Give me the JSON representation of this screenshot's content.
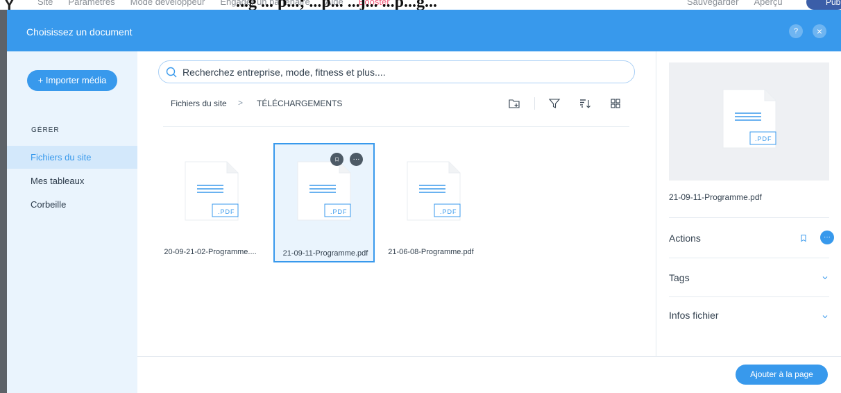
{
  "background_editor": {
    "menu": [
      "Site",
      "Paramètres",
      "Mode développeur",
      "Engager un partenaire",
      "Aide",
      "Booster"
    ],
    "title_partial": "...g ... p...; ...p... ...j... ...p...g...",
    "right_items": [
      "Sauvegarder",
      "Aperçu"
    ],
    "publish_label": "Publi"
  },
  "modal": {
    "title": "Choisissez un document",
    "help_label": "?",
    "close_label": "×"
  },
  "sidebar": {
    "import_label": "+ Importer média",
    "section_title": "GÉRER",
    "items": [
      {
        "label": "Fichiers du site",
        "active": true
      },
      {
        "label": "Mes tableaux",
        "active": false
      },
      {
        "label": "Corbeille",
        "active": false
      }
    ]
  },
  "search": {
    "placeholder": "Recherchez entreprise, mode, fitness et plus...."
  },
  "breadcrumb": {
    "root": "Fichiers du site",
    "separator": ">",
    "current": "TÉLÉCHARGEMENTS"
  },
  "toolbar": {
    "icons": [
      "new-folder-icon",
      "filter-icon",
      "sort-icon",
      "grid-view-icon"
    ]
  },
  "files": [
    {
      "name": "20-09-21-02-Programme....",
      "type_label": ".PDF",
      "selected": false
    },
    {
      "name": "21-09-11-Programme.pdf",
      "type_label": ".PDF",
      "selected": true
    },
    {
      "name": "21-06-08-Programme.pdf",
      "type_label": ".PDF",
      "selected": false
    }
  ],
  "selected_badges": {
    "bookmark": "bookmark-icon",
    "more": "···"
  },
  "right_panel": {
    "preview_type_label": ".PDF",
    "filename": "21-09-11-Programme.pdf",
    "actions_label": "Actions",
    "more_label": "···",
    "tags_label": "Tags",
    "info_label": "Infos fichier"
  },
  "footer": {
    "add_label": "Ajouter à la page"
  },
  "colors": {
    "accent": "#3899ec",
    "sidebar_bg": "#eaf4fd",
    "sidebar_active": "#d3e8fb",
    "text": "#32404e"
  }
}
